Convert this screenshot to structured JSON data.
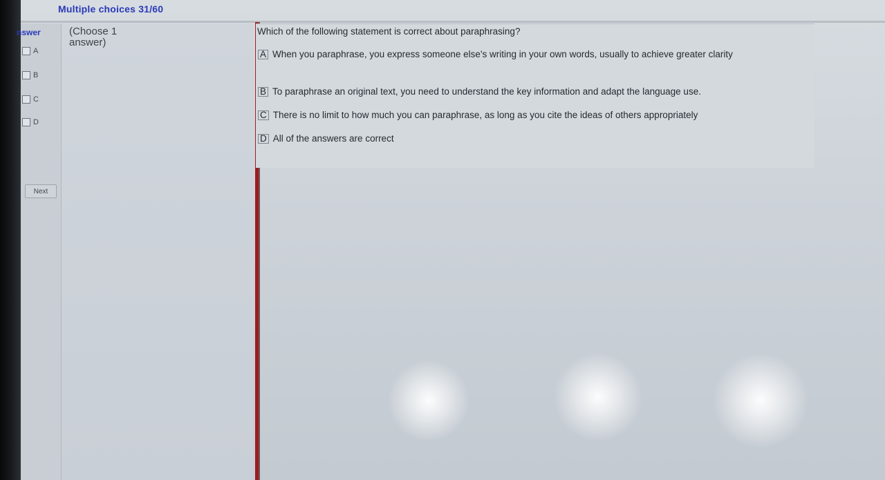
{
  "header": {
    "title": "Multiple choices 31/60"
  },
  "answer_panel": {
    "label": "nswer",
    "options": [
      {
        "label": "A",
        "checked": false
      },
      {
        "label": "B",
        "checked": false
      },
      {
        "label": "C",
        "checked": false
      },
      {
        "label": "D",
        "checked": false
      }
    ],
    "next_label": "Next"
  },
  "instruction": {
    "text": "(Choose 1 answer)"
  },
  "question": {
    "text": "Which of the following statement is correct about paraphrasing?",
    "choices": [
      {
        "letter": "A",
        "text": "When you paraphrase, you express someone else's writing in your own words, usually to achieve greater clarity"
      },
      {
        "letter": "B",
        "text": "To paraphrase an original text, you need to understand the key information and adapt the language use."
      },
      {
        "letter": "C",
        "text": "There is no limit to how much you can paraphrase, as long as you cite the ideas of others appropriately"
      },
      {
        "letter": "D",
        "text": "All of the answers are correct"
      }
    ]
  },
  "colors": {
    "accent_blue": "#2a39b8",
    "divider_red": "#9e1c20"
  }
}
